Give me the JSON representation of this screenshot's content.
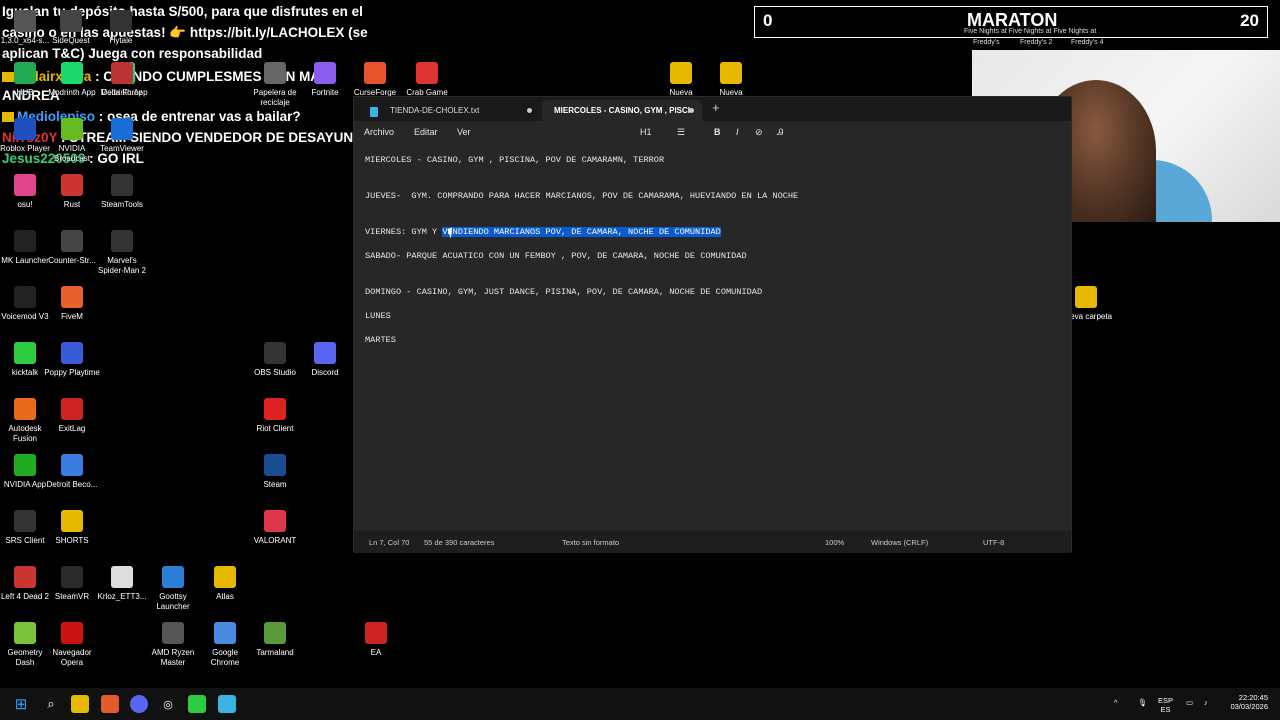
{
  "chat": {
    "messages": [
      {
        "user": "",
        "text": "Igualan tu depósito hasta S/500, para que disfrutes en el"
      },
      {
        "user": "",
        "text": "casino o en las apuestas! 👉 https://bit.ly/LACHOLEX (se"
      },
      {
        "user": "",
        "text": "aplican T&C) Juega con responsabilidad"
      },
      {
        "user": "AldairxYara",
        "text": ": CUANDO CUMPLESMES CON MAMI"
      },
      {
        "user": "",
        "text": "ANDREA"
      },
      {
        "user": "Mediolepiso",
        "text": ": osea de entrenar vas a bailar?"
      },
      {
        "user": "Nirroz0Y",
        "text": ": STREAM SIENDO VENDEDOR DE DESAYUNOS"
      },
      {
        "user": "Jesus220509",
        "text": ": GO IRL"
      }
    ],
    "colors": {
      "user1": "#e6b800",
      "user2": "#3aa0ff",
      "user3": "#37d07a"
    }
  },
  "scoreboard": {
    "left": "0",
    "title": "MARATON",
    "right": "20",
    "subtitle": "Five Nights at Five Nights at Five Nights at",
    "games": [
      "Freddy's",
      "Freddy's 2",
      "Freddy's 4"
    ]
  },
  "desktop_icons": [
    {
      "label": "1.3.0_x64-s...",
      "icon": "app-icon"
    },
    {
      "label": "SideQuest",
      "icon": "sidequest-icon"
    },
    {
      "label": "Hytale",
      "icon": "hytale-icon"
    },
    {
      "label": "HUB",
      "icon": "hub-icon"
    },
    {
      "label": "Modrinth App",
      "icon": "modrinth-icon"
    },
    {
      "label": "Delta Force",
      "icon": "delta-force-icon"
    },
    {
      "label": "Papelera de reciclaje",
      "icon": "recycle-bin-icon"
    },
    {
      "label": "Fortnite",
      "icon": "fortnite-icon"
    },
    {
      "label": "CurseForge",
      "icon": "curseforge-icon"
    },
    {
      "label": "Crab Game",
      "icon": "crab-game-icon"
    },
    {
      "label": "Nueva",
      "icon": "folder-icon"
    },
    {
      "label": "Nueva",
      "icon": "folder-icon"
    },
    {
      "label": "Roblox Player",
      "icon": "roblox-icon"
    },
    {
      "label": "NVIDIA Broadcast",
      "icon": "nvidia-broadcast-icon"
    },
    {
      "label": "TeamViewer",
      "icon": "teamviewer-icon"
    },
    {
      "label": "osu!",
      "icon": "osu-icon"
    },
    {
      "label": "Rust",
      "icon": "rust-icon"
    },
    {
      "label": "SteamTools",
      "icon": "steamtools-icon"
    },
    {
      "label": "MK Launcher",
      "icon": "mk-launcher-icon"
    },
    {
      "label": "Counter-Str...",
      "icon": "counter-strike-icon"
    },
    {
      "label": "Marvel's Spider-Man 2",
      "icon": "spiderman-icon"
    },
    {
      "label": "Voicemod V3",
      "icon": "voicemod-icon"
    },
    {
      "label": "FiveM",
      "icon": "fivem-icon"
    },
    {
      "label": "kicktalk",
      "icon": "kicktalk-icon"
    },
    {
      "label": "Poppy Playtime",
      "icon": "poppy-playtime-icon"
    },
    {
      "label": "OBS Studio",
      "icon": "obs-icon"
    },
    {
      "label": "Discord",
      "icon": "discord-icon"
    },
    {
      "label": "Autodesk Fusion",
      "icon": "autodesk-icon"
    },
    {
      "label": "ExitLag",
      "icon": "exitlag-icon"
    },
    {
      "label": "Riot Client",
      "icon": "riot-icon"
    },
    {
      "label": "NVIDIA App",
      "icon": "nvidia-app-icon"
    },
    {
      "label": "Detroit Beco...",
      "icon": "detroit-icon"
    },
    {
      "label": "Steam",
      "icon": "steam-icon"
    },
    {
      "label": "SRS Client",
      "icon": "srs-icon"
    },
    {
      "label": "SHORTS",
      "icon": "folder-icon"
    },
    {
      "label": "VALORANT",
      "icon": "valorant-icon"
    },
    {
      "label": "Left 4 Dead 2",
      "icon": "l4d2-icon"
    },
    {
      "label": "SteamVR",
      "icon": "steamvr-icon"
    },
    {
      "label": "Krloz_ETT3...",
      "icon": "file-icon"
    },
    {
      "label": "Goottsy Launcher",
      "icon": "goottsy-icon"
    },
    {
      "label": "Atlas",
      "icon": "atlas-icon"
    },
    {
      "label": "Geometry Dash",
      "icon": "geometry-dash-icon"
    },
    {
      "label": "Navegador Opera",
      "icon": "opera-icon"
    },
    {
      "label": "AMD Ryzen Master",
      "icon": "amd-icon"
    },
    {
      "label": "Google Chrome",
      "icon": "chrome-icon"
    },
    {
      "label": "Tarmaland",
      "icon": "tarmaland-icon"
    },
    {
      "label": "EA",
      "icon": "ea-icon"
    },
    {
      "label": "Nueva carpeta",
      "icon": "folder-icon"
    }
  ],
  "notepad": {
    "tabs": [
      {
        "label": "TIENDA-DE-CHOLEX.txt"
      },
      {
        "label": "MIERCOLES - CASINO, GYM , PISCI"
      }
    ],
    "menu": {
      "file": "Archivo",
      "edit": "Editar",
      "view": "Ver",
      "heading": "H1"
    },
    "lines": [
      "MIERCOLES - CASINO, GYM , PISCINA, POV DE CAMARAMN, TERROR",
      "JUEVES-  GYM. COMPRANDO PARA HACER MARCIANOS, POV DE CAMARAMA, HUEVIANDO EN LA NOCHE",
      "SABADO- PARQUE ACUATICO CON UN FEMBOY , POV, DE CAMARA, NOCHE DE COMUNIDAD",
      "DOMINGO - CASINO, GYM, JUST DANCE, PISINA, POV, DE CAMARA, NOCHE DE COMUNIDAD",
      "LUNES",
      "MARTES"
    ],
    "friday_prefix": "VIERNES: GYM Y ",
    "friday_selected": "VENDIENDO MARCIANOS POV, DE CAMARA, NOCHE DE COMUNIDAD",
    "status": {
      "position": "Ln 7, Col 70",
      "chars": "55 de 390 caracteres",
      "format": "Texto sin formato",
      "zoom": "100%",
      "eol": "Windows (CRLF)",
      "encoding": "UTF-8"
    }
  },
  "taskbar": {
    "lang": "ESP",
    "lang2": "ES",
    "time": "22:20:45",
    "date": "03/03/2026"
  }
}
